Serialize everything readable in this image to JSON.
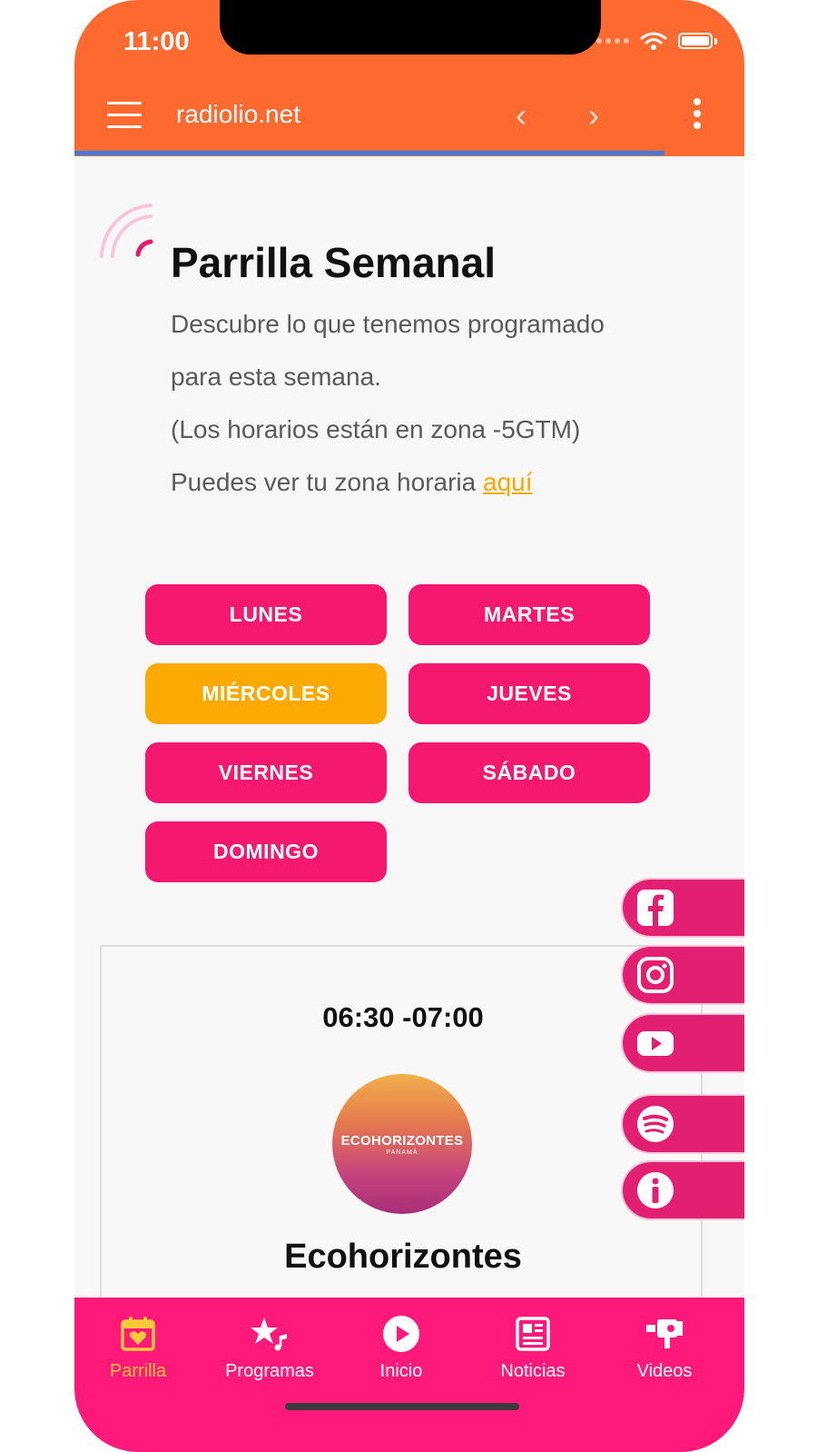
{
  "status": {
    "time": "11:00"
  },
  "appbar": {
    "title": "radiolio.net"
  },
  "page": {
    "heading": "Parrilla Semanal",
    "desc_line1": "Descubre lo que tenemos programado",
    "desc_line2": "para esta semana.",
    "desc_line3": "(Los horarios están en zona -5GTM)",
    "desc_line4": "Puedes ver tu zona horaria",
    "link_label": "aquí"
  },
  "days": [
    {
      "label": "LUNES",
      "active": false
    },
    {
      "label": "MARTES",
      "active": false
    },
    {
      "label": "MIÉRCOLES",
      "active": true
    },
    {
      "label": "JUEVES",
      "active": false
    },
    {
      "label": "VIERNES",
      "active": false
    },
    {
      "label": "SÁBADO",
      "active": false
    },
    {
      "label": "DOMINGO",
      "active": false
    }
  ],
  "program": {
    "time": "06:30 -07:00",
    "logo_main": "ECOHORIZONTES",
    "logo_sub": "PANAMÁ",
    "title": "Ecohorizontes"
  },
  "social": [
    "facebook-icon",
    "instagram-icon",
    "youtube-icon",
    "spotify-icon",
    "info-icon"
  ],
  "bottom_nav": [
    {
      "label": "Parrilla",
      "icon": "calendar-heart-icon",
      "active": true
    },
    {
      "label": "Programas",
      "icon": "star-music-icon",
      "active": false
    },
    {
      "label": "Inicio",
      "icon": "play-circle-icon",
      "active": false
    },
    {
      "label": "Noticias",
      "icon": "newspaper-icon",
      "active": false
    },
    {
      "label": "Videos",
      "icon": "video-camera-icon",
      "active": false
    }
  ],
  "colors": {
    "app_bar": "#fd6a30",
    "accent_pink": "#f5186f",
    "active_orange": "#fcaa02",
    "nav_bg": "#fe197a",
    "nav_active": "#ffc93a"
  }
}
